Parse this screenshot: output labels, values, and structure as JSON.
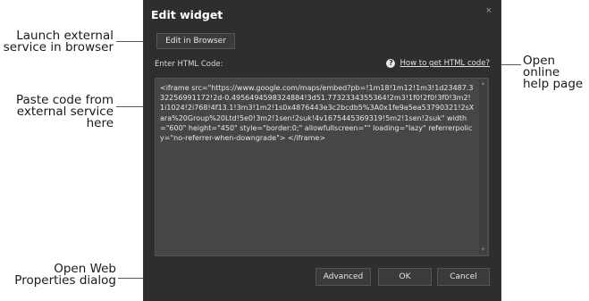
{
  "callouts": {
    "launch": [
      "Launch external",
      "service in browser"
    ],
    "paste": [
      "Paste code from",
      "external service here"
    ],
    "props": [
      "Open Web",
      "Properties dialog"
    ],
    "help": [
      "Open online",
      "help page"
    ]
  },
  "dialog": {
    "title": "Edit widget",
    "close": "×",
    "browser_button": "Edit in Browser",
    "html_label": "Enter HTML Code:",
    "help_icon": "?",
    "help_link": "How to get HTML code?",
    "code": "<iframe src=\"https://www.google.com/maps/embed?pb=!1m18!1m12!1m3!1d23487.332256991172!2d-0.4956494598324884!3d51.7732334355364!2m3!1f0!2f0!3f0!3m2!1i1024!2i768!4f13.1!3m3!1m2!1s0x4876443e3c2bcdb5%3A0x1fe9a5ea53790321!2sXara%20Group%20Ltd!5e0!3m2!1sen!2suk!4v1675445369319!5m2!1sen!2suk\" width=\"600\" height=\"450\" style=\"border:0;\" allowfullscreen=\"\" loading=\"lazy\" referrerpolicy=\"no-referrer-when-downgrade\"> </iframe>",
    "advanced_button": "Advanced",
    "ok_button": "OK",
    "cancel_button": "Cancel"
  },
  "colors": {
    "dialog_bg": "#2e2e2e",
    "codebox_bg": "#464646",
    "button_bg": "#3b3b3b"
  }
}
